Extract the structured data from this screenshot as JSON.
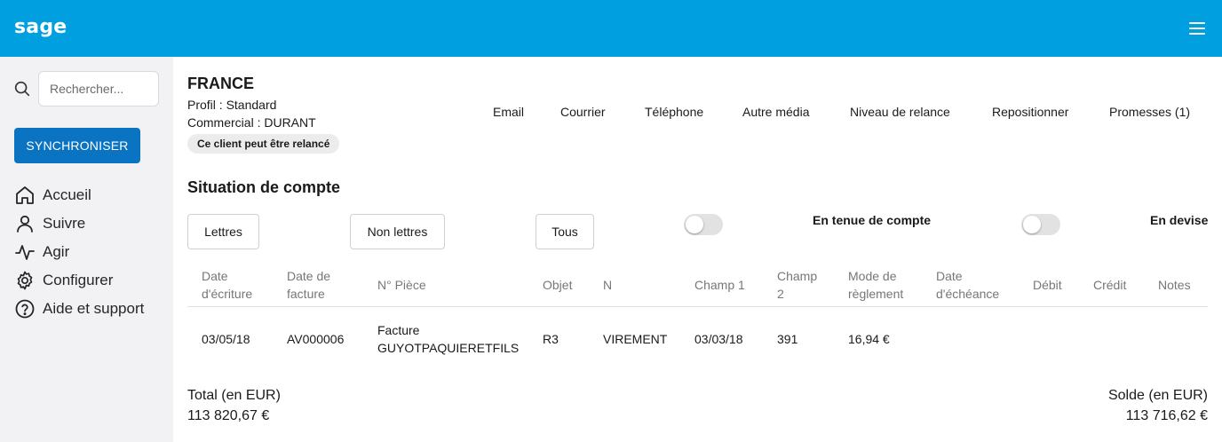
{
  "header": {
    "logo": "sage",
    "menu_icon": "hamburger-menu-icon",
    "brand_color": "#00a0e0"
  },
  "sidebar": {
    "search_icon": "search-icon",
    "search_placeholder": "Rechercher...",
    "search_value": "",
    "sync_label": "SYNCHRONISER",
    "sync_color": "#0a73c2",
    "items": [
      {
        "label": "Accueil",
        "icon": "home-icon"
      },
      {
        "label": "Suivre",
        "icon": "user-icon"
      },
      {
        "label": "Agir",
        "icon": "activity-icon"
      },
      {
        "label": "Configurer",
        "icon": "gear-icon"
      },
      {
        "label": "Aide et support",
        "icon": "help-icon"
      }
    ]
  },
  "client": {
    "name": "FRANCE",
    "profil": "Profil : Standard",
    "commercial": "Commercial : DURANT",
    "badge": "Ce client peut être relancé"
  },
  "actions": [
    "Email",
    "Courrier",
    "Téléphone",
    "Autre média",
    "Niveau de relance",
    "Repositionner",
    "Promesses (1)"
  ],
  "situation": {
    "title": "Situation de compte",
    "filters": [
      "Lettres",
      "Non lettres",
      "Tous"
    ],
    "toggles": [
      {
        "label": "En tenue de compte",
        "on": false
      },
      {
        "label": "En devise",
        "on": false
      }
    ]
  },
  "table": {
    "columns": [
      {
        "l1": "Date",
        "l2": "d'écriture"
      },
      {
        "l1": "Date de",
        "l2": "facture"
      },
      {
        "l1": "N° Pièce",
        "l2": ""
      },
      {
        "l1": "Objet",
        "l2": ""
      },
      {
        "l1": "N",
        "l2": ""
      },
      {
        "l1": "Champ 1",
        "l2": ""
      },
      {
        "l1": "Champ",
        "l2": "2"
      },
      {
        "l1": "Mode de",
        "l2": "règlement"
      },
      {
        "l1": "Date",
        "l2": "d'échéance"
      },
      {
        "l1": "Débit",
        "l2": ""
      },
      {
        "l1": "Crédit",
        "l2": ""
      },
      {
        "l1": "Notes",
        "l2": ""
      }
    ],
    "rows": [
      {
        "date_ecriture": "03/05/18",
        "date_facture": "AV000006",
        "piece_l1": "Facture",
        "piece_l2": "GUYOTPAQUIERETFILS",
        "objet": "R3",
        "n": "VIREMENT",
        "champ1": "03/03/18",
        "champ2": "391",
        "mode_reglement": "16,94 €",
        "date_echeance": "",
        "debit": "",
        "credit": "",
        "notes": ""
      }
    ]
  },
  "totals": {
    "total_label": "Total (en EUR)",
    "total_value": "113 820,67 €",
    "solde_label": "Solde (en EUR)",
    "solde_value": "113 716,62 €"
  }
}
